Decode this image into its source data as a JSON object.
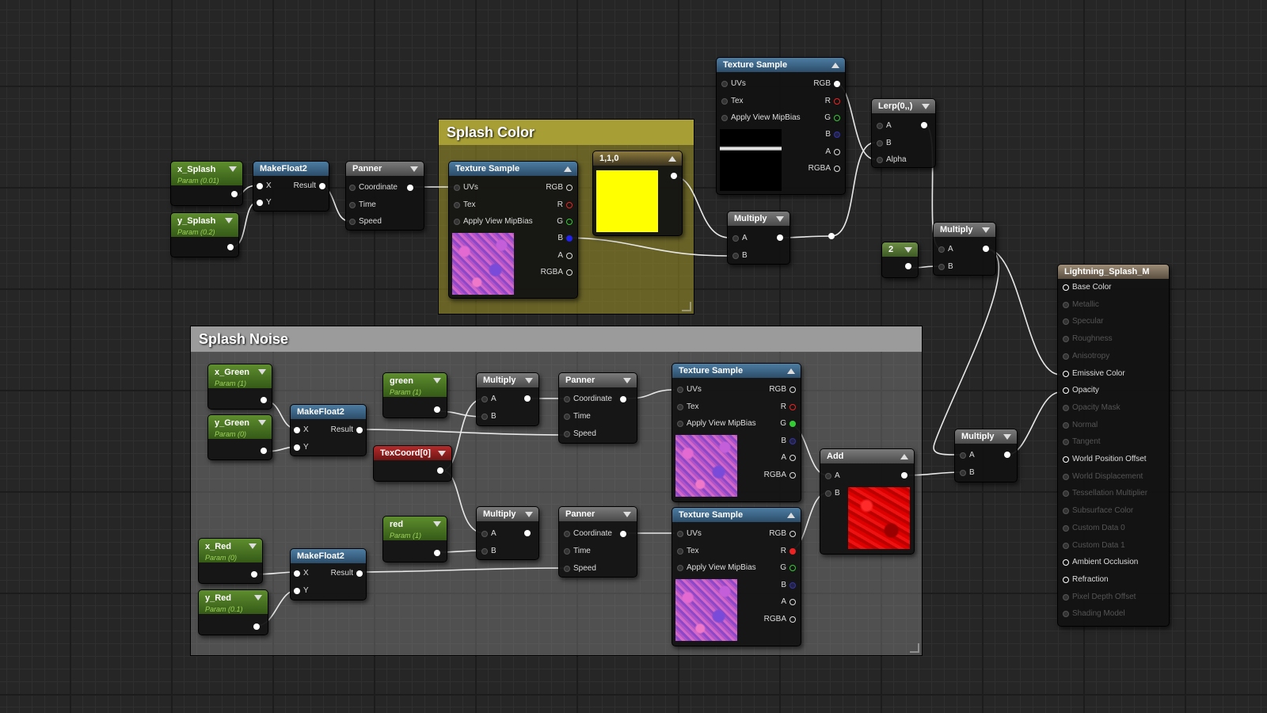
{
  "comments": {
    "splash_color": "Splash Color",
    "splash_noise": "Splash Noise"
  },
  "nodes": {
    "x_splash": {
      "title": "x_Splash",
      "sub": "Param (0.01)"
    },
    "y_splash": {
      "title": "y_Splash",
      "sub": "Param (0.2)"
    },
    "makefloat2_top": {
      "title": "MakeFloat2",
      "x": "X",
      "y": "Y",
      "result": "Result"
    },
    "panner_top": {
      "title": "Panner",
      "coordinate": "Coordinate",
      "time": "Time",
      "speed": "Speed"
    },
    "texture_sample_color": {
      "title": "Texture Sample",
      "uvs": "UVs",
      "tex": "Tex",
      "mipbias": "Apply View MipBias",
      "rgb": "RGB",
      "r": "R",
      "g": "G",
      "b": "B",
      "a": "A",
      "rgba": "RGBA"
    },
    "const_color": {
      "title": "1,1,0",
      "color": "#ffff00"
    },
    "texture_sample_top": {
      "title": "Texture Sample",
      "uvs": "UVs",
      "tex": "Tex",
      "mipbias": "Apply View MipBias",
      "rgb": "RGB",
      "r": "R",
      "g": "G",
      "b": "B",
      "a": "A",
      "rgba": "RGBA"
    },
    "multiply_1": {
      "title": "Multiply",
      "a": "A",
      "b": "B"
    },
    "lerp": {
      "title": "Lerp(0,,)",
      "a": "A",
      "b": "B",
      "alpha": "Alpha"
    },
    "const_2": {
      "title": "2"
    },
    "multiply_2": {
      "title": "Multiply",
      "a": "A",
      "b": "B"
    },
    "x_green": {
      "title": "x_Green",
      "sub": "Param (1)"
    },
    "y_green": {
      "title": "y_Green",
      "sub": "Param (0)"
    },
    "makefloat2_green": {
      "title": "MakeFloat2",
      "x": "X",
      "y": "Y",
      "result": "Result"
    },
    "green": {
      "title": "green",
      "sub": "Param (1)"
    },
    "texcoord": {
      "title": "TexCoord[0]"
    },
    "multiply_green": {
      "title": "Multiply",
      "a": "A",
      "b": "B"
    },
    "panner_green": {
      "title": "Panner",
      "coordinate": "Coordinate",
      "time": "Time",
      "speed": "Speed"
    },
    "texture_sample_green": {
      "title": "Texture Sample",
      "uvs": "UVs",
      "tex": "Tex",
      "mipbias": "Apply View MipBias",
      "rgb": "RGB",
      "r": "R",
      "g": "G",
      "b": "B",
      "a": "A",
      "rgba": "RGBA"
    },
    "x_red": {
      "title": "x_Red",
      "sub": "Param (0)"
    },
    "y_red": {
      "title": "y_Red",
      "sub": "Param (0.1)"
    },
    "makefloat2_red": {
      "title": "MakeFloat2",
      "x": "X",
      "y": "Y",
      "result": "Result"
    },
    "red": {
      "title": "red",
      "sub": "Param (1)"
    },
    "multiply_red": {
      "title": "Multiply",
      "a": "A",
      "b": "B"
    },
    "panner_red": {
      "title": "Panner",
      "coordinate": "Coordinate",
      "time": "Time",
      "speed": "Speed"
    },
    "texture_sample_red": {
      "title": "Texture Sample",
      "uvs": "UVs",
      "tex": "Tex",
      "mipbias": "Apply View MipBias",
      "rgb": "RGB",
      "r": "R",
      "g": "G",
      "b": "B",
      "a": "A",
      "rgba": "RGBA"
    },
    "add": {
      "title": "Add",
      "a": "A",
      "b": "B"
    },
    "multiply_3": {
      "title": "Multiply",
      "a": "A",
      "b": "B"
    },
    "material": {
      "title": "Lightning_Splash_M",
      "inputs": [
        {
          "label": "Base Color",
          "active": true
        },
        {
          "label": "Metallic",
          "active": false
        },
        {
          "label": "Specular",
          "active": false
        },
        {
          "label": "Roughness",
          "active": false
        },
        {
          "label": "Anisotropy",
          "active": false
        },
        {
          "label": "Emissive Color",
          "active": true
        },
        {
          "label": "Opacity",
          "active": true
        },
        {
          "label": "Opacity Mask",
          "active": false
        },
        {
          "label": "Normal",
          "active": false
        },
        {
          "label": "Tangent",
          "active": false
        },
        {
          "label": "World Position Offset",
          "active": true
        },
        {
          "label": "World Displacement",
          "active": false
        },
        {
          "label": "Tessellation Multiplier",
          "active": false
        },
        {
          "label": "Subsurface Color",
          "active": false
        },
        {
          "label": "Custom Data 0",
          "active": false
        },
        {
          "label": "Custom Data 1",
          "active": false
        },
        {
          "label": "Ambient Occlusion",
          "active": true
        },
        {
          "label": "Refraction",
          "active": true
        },
        {
          "label": "Pixel Depth Offset",
          "active": false
        },
        {
          "label": "Shading Model",
          "active": false
        }
      ]
    }
  }
}
